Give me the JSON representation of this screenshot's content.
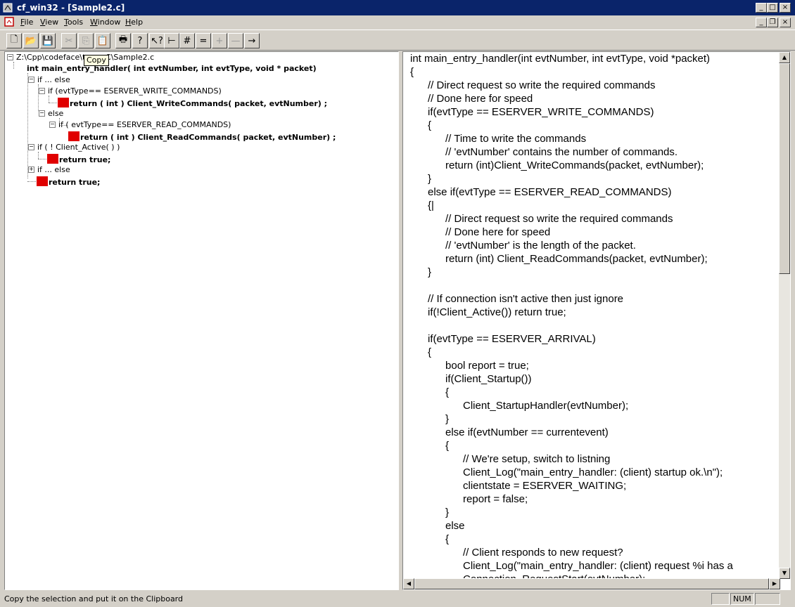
{
  "window": {
    "title": "cf_win32 - [Sample2.c]",
    "controls": [
      "_",
      "□",
      "×"
    ],
    "mdi_controls": [
      "_",
      "❐",
      "×"
    ]
  },
  "menu": {
    "items": [
      {
        "label": "File",
        "accel": "F",
        "rest": "ile"
      },
      {
        "label": "View",
        "accel": "V",
        "rest": "iew"
      },
      {
        "label": "Tools",
        "accel": "T",
        "rest": "ools"
      },
      {
        "label": "Window",
        "accel": "W",
        "rest": "indow"
      },
      {
        "label": "Help",
        "accel": "H",
        "rest": "elp"
      }
    ]
  },
  "toolbar": {
    "buttons": [
      {
        "name": "new-file-icon",
        "glyph": "🗋"
      },
      {
        "name": "open-folder-icon",
        "glyph": "📂"
      },
      {
        "name": "save-icon",
        "glyph": "💾"
      },
      {
        "name": "cut-icon",
        "glyph": "✂"
      },
      {
        "name": "copy-icon",
        "glyph": "⎘"
      },
      {
        "name": "paste-icon",
        "glyph": "📋"
      },
      {
        "name": "print-icon",
        "glyph": "🖶"
      },
      {
        "name": "help-icon",
        "glyph": "?"
      },
      {
        "name": "context-help-icon",
        "glyph": "↖?"
      },
      {
        "name": "tree-icon",
        "glyph": "⊢"
      },
      {
        "name": "hash-icon",
        "glyph": "#"
      },
      {
        "name": "equals-icon",
        "glyph": "="
      },
      {
        "name": "plus-icon",
        "glyph": "+"
      },
      {
        "name": "minus-icon",
        "glyph": "—"
      },
      {
        "name": "arrow-right-icon",
        "glyph": "→"
      }
    ],
    "tooltip": "Copy"
  },
  "tree": {
    "root_path": "Z:\\Cpp\\codeface\\te",
    "root_path_tail": "C\\Sample2.c",
    "nodes": [
      {
        "text": "int main_entry_handler( int evtNumber, int evtType, void * packet)",
        "bold": true
      },
      {
        "text": "if ... else",
        "bold": false
      },
      {
        "text": "if (evtType== ESERVER_WRITE_COMMANDS)",
        "bold": false
      },
      {
        "text": "return ( int ) Client_WriteCommands( packet, evtNumber) ;",
        "bold": true
      },
      {
        "text": "else",
        "bold": false
      },
      {
        "text": "if ( evtType== ESERVER_READ_COMMANDS)",
        "bold": false
      },
      {
        "text": "return ( int ) Client_ReadCommands( packet, evtNumber) ;",
        "bold": true
      },
      {
        "text": "if ( ! Client_Active( ) )",
        "bold": false
      },
      {
        "text": "return true;",
        "bold": true
      },
      {
        "text": "if ... else",
        "bold": false
      },
      {
        "text": "return true;",
        "bold": true
      }
    ]
  },
  "code": {
    "lines": [
      "int main_entry_handler(int evtNumber, int evtType, void *packet)",
      "{",
      "      // Direct request so write the required commands",
      "      // Done here for speed",
      "      if(evtType == ESERVER_WRITE_COMMANDS)",
      "      {",
      "            // Time to write the commands",
      "            // 'evtNumber' contains the number of commands.",
      "            return (int)Client_WriteCommands(packet, evtNumber);",
      "      }",
      "      else if(evtType == ESERVER_READ_COMMANDS)",
      "      {|",
      "            // Direct request so write the required commands",
      "            // Done here for speed",
      "            // 'evtNumber' is the length of the packet.",
      "            return (int) Client_ReadCommands(packet, evtNumber);",
      "      }",
      "",
      "      // If connection isn't active then just ignore",
      "      if(!Client_Active()) return true;",
      "",
      "      if(evtType == ESERVER_ARRIVAL)",
      "      {",
      "            bool report = true;",
      "            if(Client_Startup())",
      "            {",
      "                  Client_StartupHandler(evtNumber);",
      "            }",
      "            else if(evtNumber == currentevent)",
      "            {",
      "                  // We're setup, switch to listning",
      "                  Client_Log(\"main_entry_handler: (client) startup ok.\\n\");",
      "                  clientstate = ESERVER_WAITING;",
      "                  report = false;",
      "            }",
      "            else",
      "            {",
      "                  // Client responds to new request?",
      "                  Client_Log(\"main_entry_handler: (client) request %i has a",
      "                  Connection_RequestStart(evtNumber);"
    ]
  },
  "status": {
    "text": "Copy the selection and put it on the Clipboard",
    "num": "NUM"
  }
}
